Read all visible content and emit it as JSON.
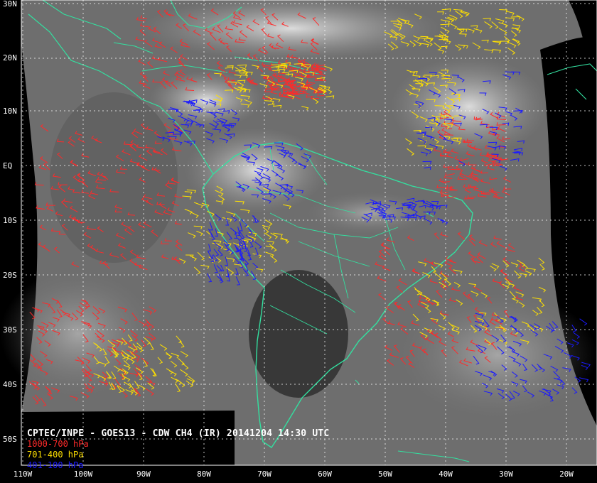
{
  "caption": {
    "title": "CPTEC/INPE - GOES13 - CDW CH4 (IR) 20141204 14:30 UTC",
    "legend": [
      {
        "label": "1000-700 hPa",
        "color": "#ff2a2a"
      },
      {
        "label": "701-400 hPa",
        "color": "#ffe000"
      },
      {
        "label": "401-100 hPa",
        "color": "#1a1aff"
      }
    ]
  },
  "lat_labels": [
    "30N",
    "20N",
    "10N",
    "EQ",
    "10S",
    "20S",
    "30S",
    "40S",
    "50S"
  ],
  "lon_labels": [
    "110W",
    "100W",
    "90W",
    "80W",
    "70W",
    "60W",
    "50W",
    "40W",
    "30W",
    "20W"
  ],
  "colors": {
    "background": "#000000",
    "coastline": "#33e0a0",
    "grid": "#ffffff",
    "low_level_wind": "#ff2a2a",
    "mid_level_wind": "#ffe000",
    "high_level_wind": "#1a1aff"
  }
}
